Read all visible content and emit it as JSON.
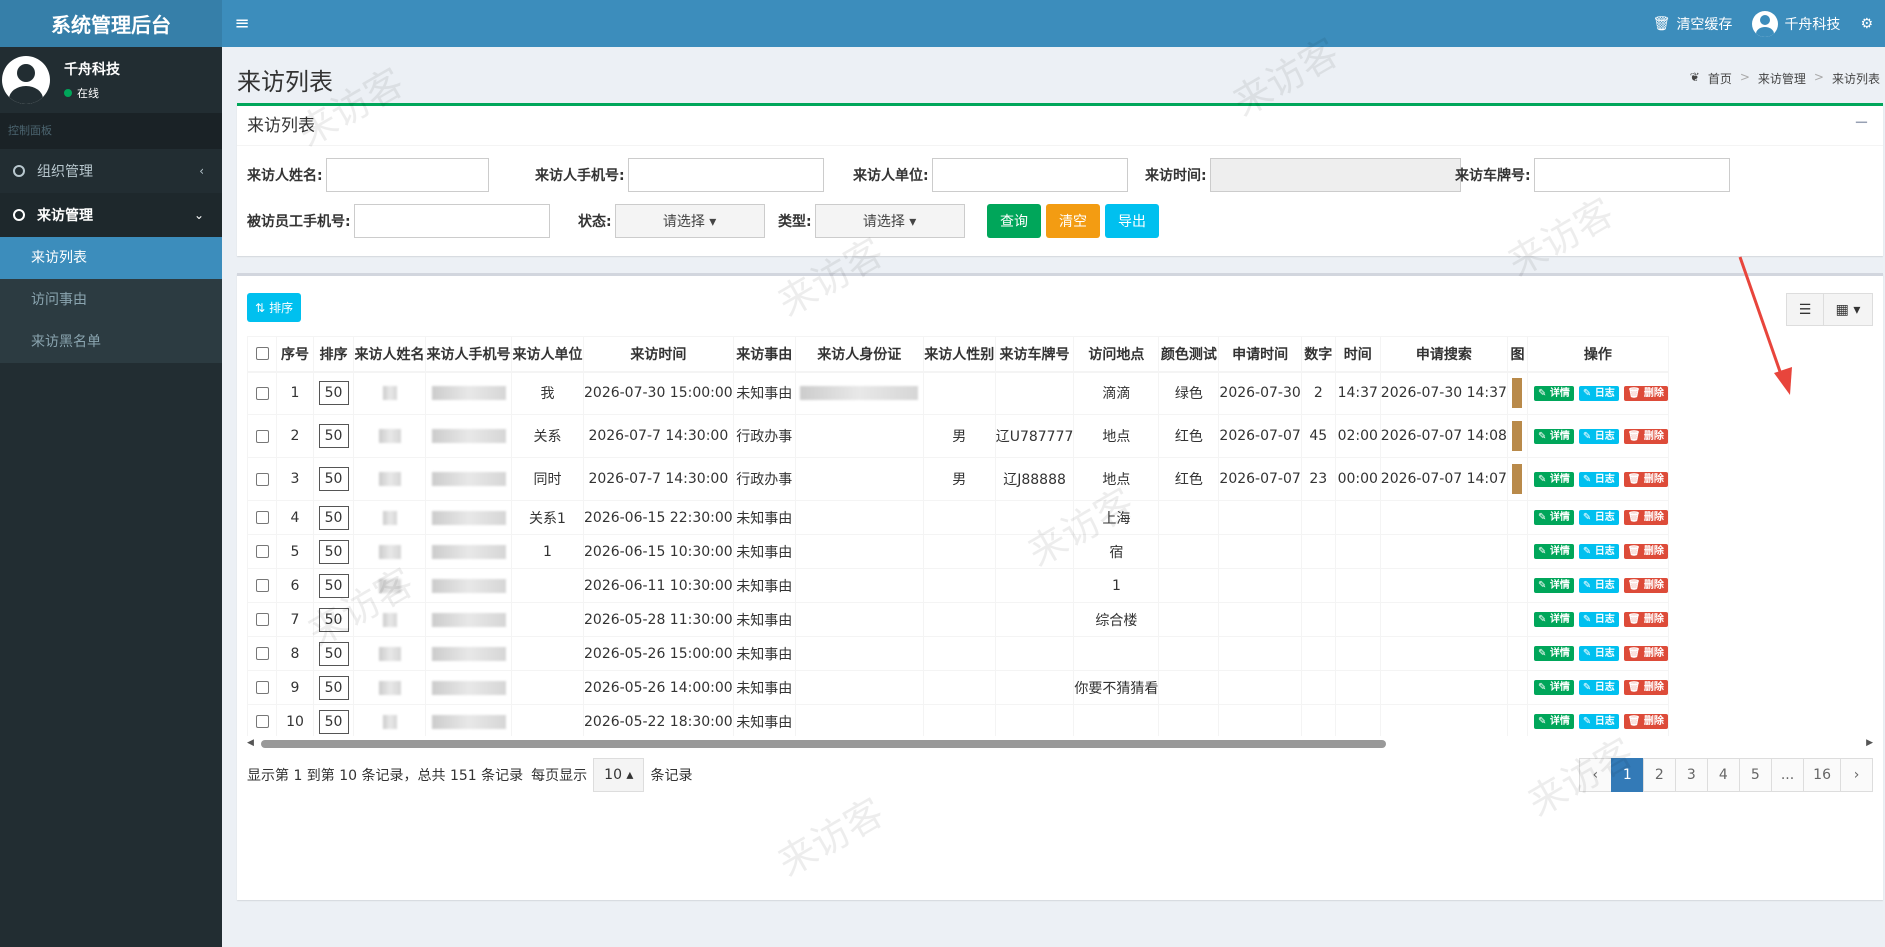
{
  "app": {
    "logo": "系统管理后台"
  },
  "topbar": {
    "clear_cache": "清空缓存",
    "user": "千舟科技",
    "toggle": "≡",
    "settings_icon": "gear-icon"
  },
  "sidebar": {
    "user_name": "千舟科技",
    "status": "在线",
    "menu_header": "控制面板",
    "items": [
      {
        "label": "组织管理",
        "caret": "‹"
      },
      {
        "label": "来访管理",
        "caret": "⌄"
      }
    ],
    "subitems": [
      "来访列表",
      "访问事由",
      "来访黑名单"
    ]
  },
  "page": {
    "title": "来访列表",
    "breadcrumb": [
      "首页",
      "来访管理",
      "来访列表"
    ]
  },
  "search_box": {
    "title": "来访列表",
    "collapse": "−",
    "fields": {
      "name": "来访人姓名:",
      "phone": "来访人手机号:",
      "unit": "来访人单位:",
      "time": "来访时间:",
      "plate": "来访车牌号:",
      "staff_phone": "被访员工手机号:",
      "status": "状态:",
      "type": "类型:"
    },
    "select_placeholder": "请选择 ▾",
    "buttons": {
      "query": "查询",
      "clear": "清空",
      "export": "导出"
    }
  },
  "table_box": {
    "sort_button": "排序",
    "list_icon": "☰",
    "grid_icon": "▦ ▾",
    "columns": [
      "序号",
      "排序",
      "来访人姓名",
      "来访人手机号",
      "来访人单位",
      "来访时间",
      "来访事由",
      "来访人身份证",
      "来访人性别",
      "来访车牌号",
      "访问地点",
      "颜色测试",
      "申请时间",
      "数字",
      "时间",
      "申请搜索",
      "图",
      "操作"
    ],
    "actions": {
      "detail": "✎ 详情",
      "log": "✎ 日志",
      "delete": "🗑 删除"
    },
    "rows": [
      {
        "no": "1",
        "sort": "50",
        "unit": "我",
        "time": "2026-07-30 15:00:00",
        "reason": "未知事由",
        "gender": "",
        "plate": "",
        "place": "滴滴",
        "color": "绿色",
        "apply": "2026-07-30",
        "num": "2",
        "t": "14:37",
        "search": "2026-07-30 14:37"
      },
      {
        "no": "2",
        "sort": "50",
        "unit": "关系",
        "time": "2026-07-7 14:30:00",
        "reason": "行政办事",
        "gender": "男",
        "plate": "辽U787777",
        "place": "地点",
        "color": "红色",
        "apply": "2026-07-07",
        "num": "45",
        "t": "02:00",
        "search": "2026-07-07 14:08"
      },
      {
        "no": "3",
        "sort": "50",
        "unit": "同时",
        "time": "2026-07-7 14:30:00",
        "reason": "行政办事",
        "gender": "男",
        "plate": "辽J88888",
        "place": "地点",
        "color": "红色",
        "apply": "2026-07-07",
        "num": "23",
        "t": "00:00",
        "search": "2026-07-07 14:07"
      },
      {
        "no": "4",
        "sort": "50",
        "unit": "关系1",
        "time": "2026-06-15 22:30:00",
        "reason": "未知事由",
        "gender": "",
        "plate": "",
        "place": "上海",
        "color": "",
        "apply": "",
        "num": "",
        "t": "",
        "search": ""
      },
      {
        "no": "5",
        "sort": "50",
        "unit": "1",
        "time": "2026-06-15 10:30:00",
        "reason": "未知事由",
        "gender": "",
        "plate": "",
        "place": "宿",
        "color": "",
        "apply": "",
        "num": "",
        "t": "",
        "search": ""
      },
      {
        "no": "6",
        "sort": "50",
        "unit": "",
        "time": "2026-06-11 10:30:00",
        "reason": "未知事由",
        "gender": "",
        "plate": "",
        "place": "1",
        "color": "",
        "apply": "",
        "num": "",
        "t": "",
        "search": ""
      },
      {
        "no": "7",
        "sort": "50",
        "unit": "",
        "time": "2026-05-28 11:30:00",
        "reason": "未知事由",
        "gender": "",
        "plate": "",
        "place": "综合楼",
        "color": "",
        "apply": "",
        "num": "",
        "t": "",
        "search": ""
      },
      {
        "no": "8",
        "sort": "50",
        "unit": "",
        "time": "2026-05-26 15:00:00",
        "reason": "未知事由",
        "gender": "",
        "plate": "",
        "place": "",
        "color": "",
        "apply": "",
        "num": "",
        "t": "",
        "search": ""
      },
      {
        "no": "9",
        "sort": "50",
        "unit": "",
        "time": "2026-05-26 14:00:00",
        "reason": "未知事由",
        "gender": "",
        "plate": "",
        "place": "你要不猜猜看",
        "color": "",
        "apply": "",
        "num": "",
        "t": "",
        "search": ""
      },
      {
        "no": "10",
        "sort": "50",
        "unit": "",
        "time": "2026-05-22 18:30:00",
        "reason": "未知事由",
        "gender": "",
        "plate": "",
        "place": "",
        "color": "",
        "apply": "",
        "num": "",
        "t": "",
        "search": ""
      }
    ],
    "footer": {
      "info": "显示第 1 到第 10 条记录，总共 151 条记录",
      "per_page_prefix": "每页显示",
      "per_page": "10 ▴",
      "per_page_suffix": "条记录"
    },
    "pager": [
      "‹",
      "1",
      "2",
      "3",
      "4",
      "5",
      "...",
      "16",
      "›"
    ]
  },
  "watermark": "来访客",
  "colors": {
    "header": "#3c8dbc",
    "logo": "#367fa9",
    "sidebar": "#222d32",
    "green": "#00a65a",
    "orange": "#f39c12",
    "cyan": "#00c0ef",
    "red": "#dd4b39"
  }
}
